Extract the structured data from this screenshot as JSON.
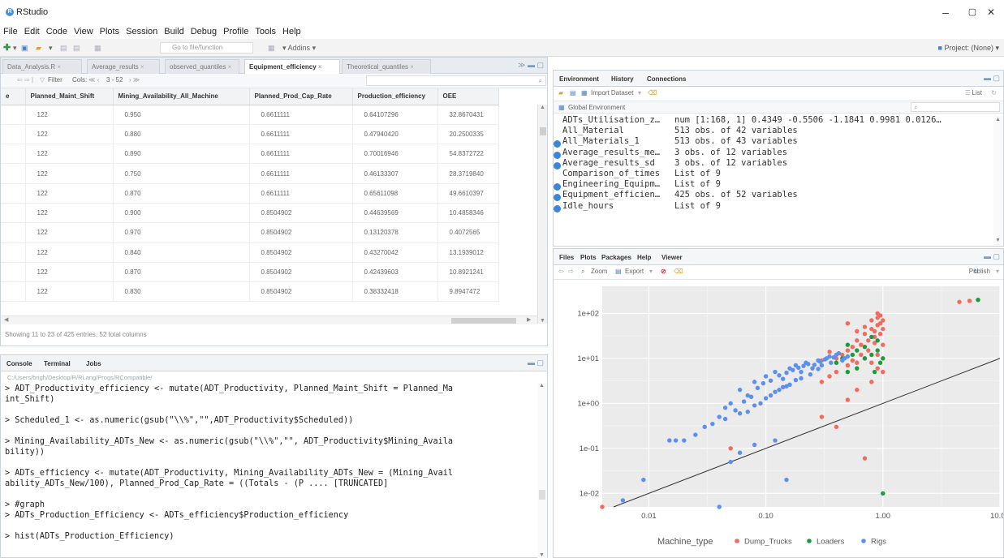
{
  "window": {
    "title": "RStudio",
    "minimize": "–",
    "maximize": "▢",
    "close": "✕"
  },
  "menu": [
    "File",
    "Edit",
    "Code",
    "View",
    "Plots",
    "Session",
    "Build",
    "Debug",
    "Profile",
    "Tools",
    "Help"
  ],
  "toolbar": {
    "goto_placeholder": "Go to file/function",
    "addins": "Addins",
    "project": "Project: (None)"
  },
  "source": {
    "tabs": [
      "Data_Analysis.R",
      "Average_results",
      "observed_quantiles",
      "Equipment_efficiency",
      "Theoretical_quantiles"
    ],
    "active_tab": "Equipment_efficiency",
    "filter_label": "Filter",
    "cols_label": "Cols:",
    "cols_range": "3 - 52",
    "columns": [
      "e",
      "Planned_Maint_Shift",
      "Mining_Availability_All_Machine",
      "Planned_Prod_Cap_Rate",
      "Production_efficiency",
      "OEE"
    ],
    "rows": [
      [
        "",
        "122",
        "0.950",
        "0.6611111",
        "0.64107296",
        "32.8670431"
      ],
      [
        "",
        "122",
        "0.880",
        "0.6611111",
        "0.47940420",
        "20.2500335"
      ],
      [
        "",
        "122",
        "0.890",
        "0.6611111",
        "0.70016946",
        "54.8372722"
      ],
      [
        "",
        "122",
        "0.750",
        "0.6611111",
        "0.46133307",
        "28.3719840"
      ],
      [
        "",
        "122",
        "0.870",
        "0.6611111",
        "0.65611098",
        "49.6610397"
      ],
      [
        "",
        "122",
        "0.900",
        "0.8504902",
        "0.44639569",
        "10.4858346"
      ],
      [
        "",
        "122",
        "0.970",
        "0.8504902",
        "0.13120378",
        "0.4072565"
      ],
      [
        "",
        "122",
        "0.840",
        "0.8504902",
        "0.43270042",
        "13.1939012"
      ],
      [
        "",
        "122",
        "0.870",
        "0.8504902",
        "0.42439603",
        "10.8921241"
      ],
      [
        "",
        "122",
        "0.830",
        "0.8504902",
        "0.38332418",
        "9.8947472"
      ]
    ],
    "status": "Showing 11 to 23 of 425 entries, 52 total columns"
  },
  "console": {
    "tabs": [
      "Console",
      "Terminal",
      "Jobs"
    ],
    "path": "C:/Users/brigh/Desktop/R/RLang/Progs/RCompatible/",
    "lines": [
      "> ADT_Productivity_efficiency <- mutate(ADT_Productivity, Planned_Maint_Shift = Planned_Ma",
      "int_Shift)",
      "",
      "> Scheduled_1 <- as.numeric(gsub(\"\\\\%\",\"\",ADT_Productivity$Scheduled))",
      "",
      "> Mining_Availability_ADTs_New <- as.numeric(gsub(\"\\\\%\",\"\", ADT_Productivity$Mining_Availa",
      "bility))",
      "",
      "> ADTs_efficiency <- mutate(ADT_Productivity, Mining_Availability_ADTs_New = (Mining_Avail",
      "ability_ADTs_New/100), Planned_Prod_Cap_Rate = ((Totals - (P .... [TRUNCATED]",
      "",
      "> #graph",
      "> ADTs_Production_Efficiency <- ADTs_efficiency$Production_efficiency",
      "",
      "> hist(ADTs_Production_Efficiency)"
    ]
  },
  "environment": {
    "tabs": [
      "Environment",
      "History",
      "Connections"
    ],
    "import_label": "Import Dataset",
    "list_label": "List",
    "scope": "Global Environment",
    "rows": [
      {
        "dot": false,
        "name": "ADTs_Utilisation_z…",
        "value": "num [1:168, 1] 0.4349 -0.5506 -1.1841 0.9981 0.0126…"
      },
      {
        "dot": false,
        "name": "All_Material",
        "value": "513 obs. of 42 variables"
      },
      {
        "dot": true,
        "name": "All_Materials_1",
        "value": "513 obs. of 43 variables"
      },
      {
        "dot": true,
        "name": "Average_results_me…",
        "value": "3 obs. of 12 variables"
      },
      {
        "dot": true,
        "name": "Average_results_sd",
        "value": "3 obs. of 12 variables"
      },
      {
        "dot": false,
        "name": "Comparison_of_times",
        "value": "List of 9"
      },
      {
        "dot": true,
        "name": "Engineering_Equipm…",
        "value": "List of 9"
      },
      {
        "dot": true,
        "name": "Equipment_efficien…",
        "value": "425 obs. of 52 variables"
      },
      {
        "dot": true,
        "name": "Idle_hours",
        "value": "List of 9"
      }
    ]
  },
  "files": {
    "tabs": [
      "Files",
      "Plots",
      "Packages",
      "Help",
      "Viewer"
    ],
    "zoom_label": "Zoom",
    "export_label": "Export",
    "publish_label": "Publish"
  },
  "colors": {
    "dump_trucks": "#f26b5e",
    "loaders": "#1a9c3a",
    "rigs": "#5b8ff0",
    "panel": "#ebebeb"
  },
  "chart_data": {
    "type": "scatter",
    "title": "",
    "xlabel": "",
    "ylabel": "",
    "x_scale": "log10",
    "y_scale": "log10",
    "xlim": [
      0.004,
      10
    ],
    "ylim": [
      0.005,
      400
    ],
    "x_ticks": [
      0.01,
      0.1,
      1,
      10
    ],
    "x_tick_labels": [
      "0.01",
      "0.10",
      "1.00",
      "10.00"
    ],
    "y_ticks": [
      0.01,
      0.1,
      1,
      10,
      100
    ],
    "y_tick_labels": [
      "1e-02",
      "1e-01",
      "1e+00",
      "1e+01",
      "1e+02"
    ],
    "legend_title": "Machine_type",
    "legend_position": "bottom",
    "reference_line": {
      "intercept": 0,
      "slope": 1
    },
    "series": [
      {
        "name": "Dump_Trucks",
        "points": [
          [
            0.5,
            60
          ],
          [
            0.6,
            40
          ],
          [
            0.7,
            50
          ],
          [
            0.8,
            70
          ],
          [
            0.9,
            80
          ],
          [
            0.95,
            60
          ],
          [
            0.85,
            30
          ],
          [
            0.75,
            25
          ],
          [
            0.65,
            20
          ],
          [
            0.55,
            18
          ],
          [
            0.5,
            15
          ],
          [
            0.45,
            12
          ],
          [
            0.4,
            10
          ],
          [
            0.35,
            14
          ],
          [
            0.3,
            9
          ],
          [
            0.6,
            25
          ],
          [
            0.7,
            35
          ],
          [
            0.8,
            45
          ],
          [
            0.9,
            55
          ],
          [
            1.0,
            70
          ],
          [
            0.95,
            90
          ],
          [
            0.9,
            100
          ],
          [
            0.85,
            40
          ],
          [
            0.75,
            15
          ],
          [
            0.65,
            12
          ],
          [
            0.55,
            9
          ],
          [
            0.5,
            7
          ],
          [
            0.4,
            5
          ],
          [
            0.35,
            4
          ],
          [
            0.3,
            3
          ],
          [
            0.7,
            10
          ],
          [
            0.8,
            8
          ],
          [
            0.9,
            12
          ],
          [
            1.0,
            20
          ],
          [
            1.0,
            45
          ],
          [
            0.95,
            35
          ],
          [
            0.85,
            22
          ],
          [
            0.6,
            2
          ],
          [
            0.7,
            0.06
          ],
          [
            0.4,
            0.3
          ],
          [
            0.05,
            0.1
          ],
          [
            4.5,
            180
          ],
          [
            5.5,
            190
          ],
          [
            0.3,
            0.5
          ],
          [
            0.5,
            1.2
          ],
          [
            0.8,
            3
          ],
          [
            1.0,
            5
          ],
          [
            0.9,
            6
          ],
          [
            0.6,
            8
          ],
          [
            0.004,
            0.005
          ]
        ]
      },
      {
        "name": "Loaders",
        "points": [
          [
            6.5,
            200
          ],
          [
            0.5,
            20
          ],
          [
            0.6,
            15
          ],
          [
            0.7,
            10
          ],
          [
            0.8,
            12
          ],
          [
            0.9,
            25
          ],
          [
            0.4,
            8
          ],
          [
            0.5,
            5
          ],
          [
            0.6,
            6
          ],
          [
            0.7,
            18
          ],
          [
            0.8,
            30
          ],
          [
            0.9,
            15
          ],
          [
            1.0,
            10
          ],
          [
            0.95,
            8
          ],
          [
            0.85,
            5
          ],
          [
            1.0,
            0.01
          ],
          [
            0.45,
            10
          ],
          [
            0.55,
            12
          ]
        ]
      },
      {
        "name": "Rigs",
        "points": [
          [
            0.05,
            1
          ],
          [
            0.06,
            2
          ],
          [
            0.07,
            1.5
          ],
          [
            0.08,
            3
          ],
          [
            0.1,
            4
          ],
          [
            0.12,
            5
          ],
          [
            0.14,
            3.5
          ],
          [
            0.16,
            6
          ],
          [
            0.18,
            7
          ],
          [
            0.2,
            5
          ],
          [
            0.22,
            8
          ],
          [
            0.25,
            6
          ],
          [
            0.28,
            9
          ],
          [
            0.3,
            7
          ],
          [
            0.33,
            10
          ],
          [
            0.36,
            8
          ],
          [
            0.4,
            12
          ],
          [
            0.45,
            9
          ],
          [
            0.5,
            11
          ],
          [
            0.04,
            0.5
          ],
          [
            0.045,
            0.8
          ],
          [
            0.055,
            0.7
          ],
          [
            0.065,
            1.1
          ],
          [
            0.075,
            1.4
          ],
          [
            0.085,
            2.2
          ],
          [
            0.095,
            2.8
          ],
          [
            0.11,
            3.2
          ],
          [
            0.13,
            4.2
          ],
          [
            0.15,
            4.8
          ],
          [
            0.17,
            5.5
          ],
          [
            0.19,
            6.2
          ],
          [
            0.21,
            6.8
          ],
          [
            0.23,
            7.5
          ],
          [
            0.26,
            7.2
          ],
          [
            0.29,
            8.5
          ],
          [
            0.32,
            9.5
          ],
          [
            0.35,
            11
          ],
          [
            0.38,
            10.5
          ],
          [
            0.42,
            13
          ],
          [
            0.47,
            10
          ],
          [
            0.03,
            0.3
          ],
          [
            0.025,
            0.2
          ],
          [
            0.02,
            0.15
          ],
          [
            0.035,
            0.35
          ],
          [
            0.045,
            0.45
          ],
          [
            0.06,
            0.6
          ],
          [
            0.08,
            0.9
          ],
          [
            0.1,
            1.3
          ],
          [
            0.12,
            1.8
          ],
          [
            0.14,
            2.3
          ],
          [
            0.16,
            2.6
          ],
          [
            0.18,
            3.3
          ],
          [
            0.2,
            3.6
          ],
          [
            0.24,
            4.4
          ],
          [
            0.28,
            5.8
          ],
          [
            0.07,
            0.65
          ],
          [
            0.09,
            1.0
          ],
          [
            0.11,
            1.5
          ],
          [
            0.13,
            2.0
          ],
          [
            0.15,
            2.4
          ],
          [
            0.017,
            0.15
          ],
          [
            0.015,
            0.15
          ],
          [
            0.009,
            0.02
          ],
          [
            0.006,
            0.007
          ],
          [
            0.12,
            0.15
          ],
          [
            0.15,
            0.02
          ],
          [
            0.04,
            0.005
          ],
          [
            0.05,
            0.05
          ],
          [
            0.06,
            0.08
          ],
          [
            0.08,
            0.12
          ]
        ]
      }
    ]
  }
}
